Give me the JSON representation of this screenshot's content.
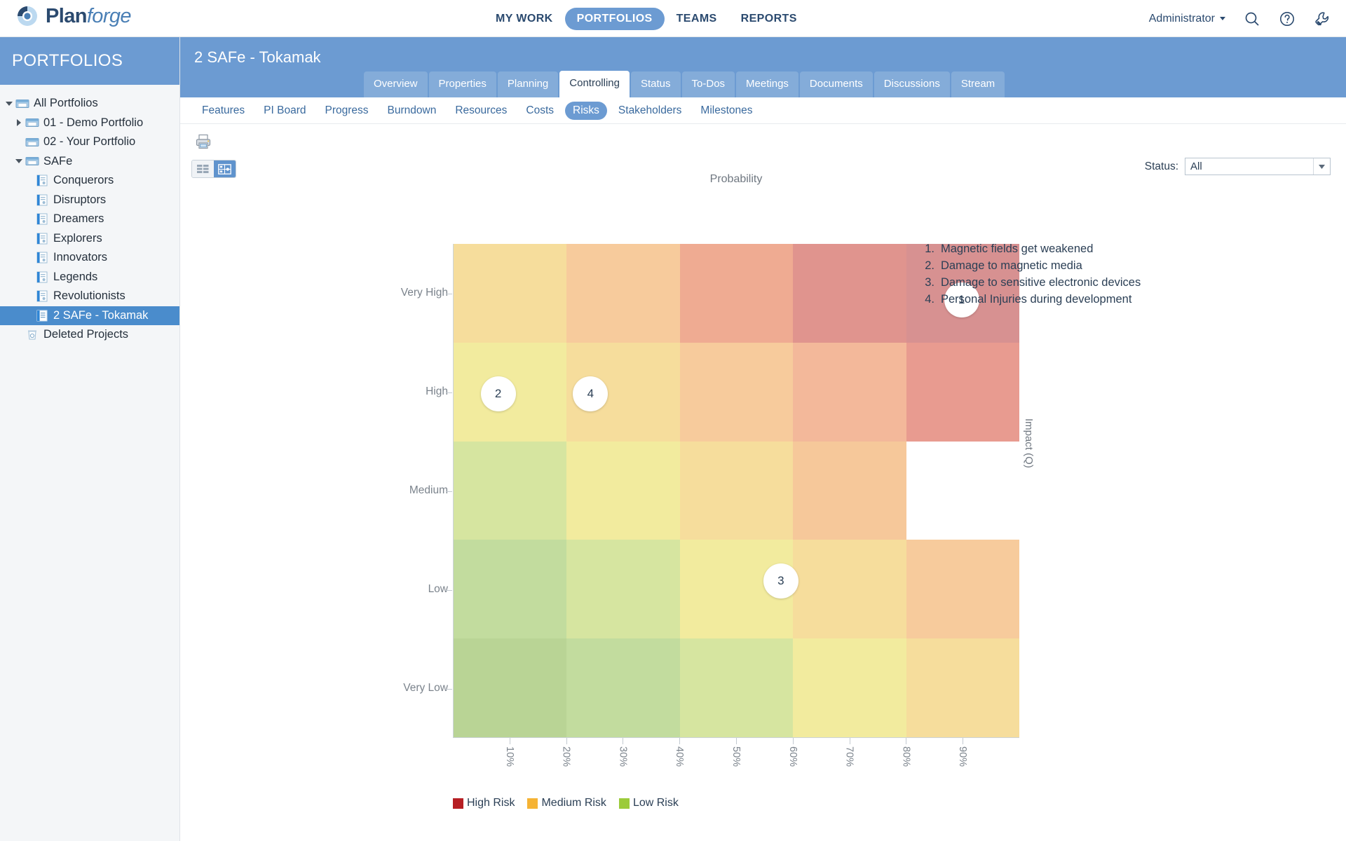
{
  "brand": {
    "name_bold": "Plan",
    "name_italic": "forge",
    "logo_icon": "planforge-circle-logo"
  },
  "topnav": {
    "items": [
      {
        "label": "MY WORK",
        "active": false
      },
      {
        "label": "PORTFOLIOS",
        "active": true
      },
      {
        "label": "TEAMS",
        "active": false
      },
      {
        "label": "REPORTS",
        "active": false
      }
    ],
    "user": "Administrator",
    "icons": [
      "search-icon",
      "help-icon",
      "settings-wrench-icon"
    ]
  },
  "sidebar": {
    "header": "PORTFOLIOS",
    "items": [
      {
        "label": "All Portfolios",
        "depth": 0,
        "twisty": "down",
        "icon": "portfolio-folder-icon",
        "selected": false
      },
      {
        "label": "01 - Demo Portfolio",
        "depth": 1,
        "twisty": "right",
        "icon": "portfolio-folder-icon",
        "selected": false
      },
      {
        "label": "02 - Your Portfolio",
        "depth": 1,
        "twisty": "none",
        "icon": "portfolio-folder-icon",
        "selected": false
      },
      {
        "label": "SAFe",
        "depth": 1,
        "twisty": "down",
        "icon": "portfolio-folder-icon",
        "selected": false
      },
      {
        "label": "Conquerors",
        "depth": 2,
        "twisty": "none",
        "icon": "project-icon",
        "selected": false
      },
      {
        "label": "Disruptors",
        "depth": 2,
        "twisty": "none",
        "icon": "project-icon",
        "selected": false
      },
      {
        "label": "Dreamers",
        "depth": 2,
        "twisty": "none",
        "icon": "project-icon",
        "selected": false
      },
      {
        "label": "Explorers",
        "depth": 2,
        "twisty": "none",
        "icon": "project-icon",
        "selected": false
      },
      {
        "label": "Innovators",
        "depth": 2,
        "twisty": "none",
        "icon": "project-icon",
        "selected": false
      },
      {
        "label": "Legends",
        "depth": 2,
        "twisty": "none",
        "icon": "project-icon",
        "selected": false
      },
      {
        "label": "Revolutionists",
        "depth": 2,
        "twisty": "none",
        "icon": "project-icon",
        "selected": false
      },
      {
        "label": "2 SAFe - Tokamak",
        "depth": 2,
        "twisty": "none",
        "icon": "project-selected-icon",
        "selected": true
      },
      {
        "label": "Deleted Projects",
        "depth": 1,
        "twisty": "none",
        "icon": "trash-icon",
        "selected": false
      }
    ]
  },
  "project": {
    "title": "2 SAFe - Tokamak",
    "tabs": [
      {
        "label": "Overview",
        "active": false
      },
      {
        "label": "Properties",
        "active": false
      },
      {
        "label": "Planning",
        "active": false
      },
      {
        "label": "Controlling",
        "active": true
      },
      {
        "label": "Status",
        "active": false
      },
      {
        "label": "To-Dos",
        "active": false
      },
      {
        "label": "Meetings",
        "active": false
      },
      {
        "label": "Documents",
        "active": false
      },
      {
        "label": "Discussions",
        "active": false
      },
      {
        "label": "Stream",
        "active": false
      }
    ],
    "subtabs": [
      {
        "label": "Features",
        "active": false
      },
      {
        "label": "PI Board",
        "active": false
      },
      {
        "label": "Progress",
        "active": false
      },
      {
        "label": "Burndown",
        "active": false
      },
      {
        "label": "Resources",
        "active": false
      },
      {
        "label": "Costs",
        "active": false
      },
      {
        "label": "Risks",
        "active": true
      },
      {
        "label": "Stakeholders",
        "active": false
      },
      {
        "label": "Milestones",
        "active": false
      }
    ]
  },
  "toolbar": {
    "print_icon": "printer-icon",
    "view_list_icon": "list-view-icon",
    "view_matrix_icon": "matrix-view-icon",
    "active_view": "matrix"
  },
  "filter": {
    "label": "Status:",
    "value": "All",
    "arrow_icon": "chevron-down-icon"
  },
  "risks": [
    {
      "num": "1.",
      "text": "Magnetic fields get weakened"
    },
    {
      "num": "2.",
      "text": "Damage to magnetic media"
    },
    {
      "num": "3.",
      "text": "Damage to sensitive electronic devices"
    },
    {
      "num": "4.",
      "text": "Personal Injuries during development"
    }
  ],
  "chart_data": {
    "type": "heatmap",
    "title": "Probability",
    "xlabel": "Probability",
    "ylabel": "Impact (Q)",
    "x_ticks": [
      "10%",
      "20%",
      "30%",
      "40%",
      "50%",
      "60%",
      "70%",
      "80%",
      "90%"
    ],
    "y_ticks": [
      "Very High",
      "High",
      "Medium",
      "Low",
      "Very Low"
    ],
    "categories": [
      "Very Low",
      "Low",
      "Medium",
      "High",
      "Very High"
    ],
    "grid": false,
    "legend_position": "bottom-left",
    "cell_colors": [
      [
        "#f6dd9c",
        "#f7cb9c",
        "#efab92",
        "#e0948e",
        "#d79191"
      ],
      [
        "#f2eb9e",
        "#f6dd9c",
        "#f7cb9c",
        "#f3b89a",
        "#e89b90"
      ],
      [
        "#d6e5a0",
        "#f2eb9e",
        "#f6dd9c",
        "#f6c89a",
        "# efb095"
      ],
      [
        "#c2dc9e",
        "#d6e5a0",
        "#f2eb9e",
        "#f6dd9c",
        "#f7cb9c"
      ],
      [
        "#b9d495",
        "#c2dc9e",
        "#d6e5a0",
        "#f2eb9e",
        "#f6dd9c"
      ]
    ],
    "points": [
      {
        "id": "1",
        "label": "Magnetic fields get weakened",
        "probability": 90,
        "impact": "Very High",
        "col": 5,
        "row": 1,
        "x_pct": 89.8,
        "y_pct": 11.3
      },
      {
        "id": "2",
        "label": "Damage to magnetic media",
        "probability": 10,
        "impact": "High",
        "col": 1,
        "row": 2,
        "x_pct": 8.0,
        "y_pct": 30.3
      },
      {
        "id": "4",
        "label": "Personal Injuries during development",
        "probability": 30,
        "impact": "High",
        "col": 2,
        "row": 2,
        "x_pct": 24.3,
        "y_pct": 30.3
      },
      {
        "id": "3",
        "label": "Damage to sensitive electronic devices",
        "probability": 70,
        "impact": "Low",
        "col": 4,
        "row": 4,
        "x_pct": 57.9,
        "y_pct": 68.2
      }
    ],
    "legend": [
      {
        "label": "High Risk",
        "color": "#b61f24"
      },
      {
        "label": "Medium Risk",
        "color": "#f5b335"
      },
      {
        "label": "Low Risk",
        "color": "#9ccb3b"
      }
    ]
  },
  "colors": {
    "brand_blue": "#6c9bd2",
    "header_blue": "#4a8ccc",
    "text_dark": "#2b3f55"
  }
}
